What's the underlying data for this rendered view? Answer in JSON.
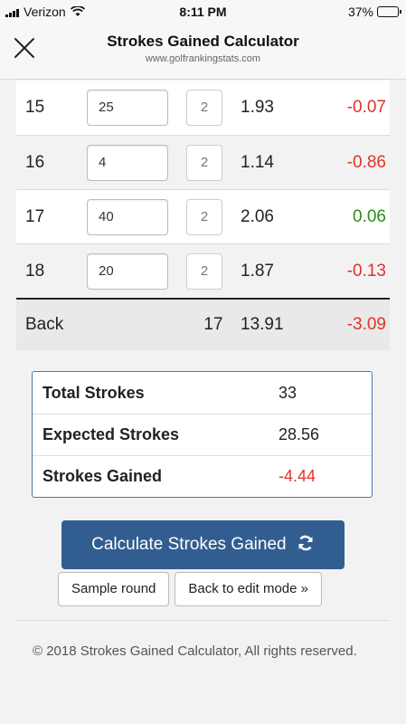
{
  "status_bar": {
    "carrier": "Verizon",
    "time": "8:11 PM",
    "battery": "37%",
    "battery_level": 0.37
  },
  "nav": {
    "title": "Strokes Gained Calculator",
    "url": "www.golfrankingstats.com"
  },
  "holes": [
    {
      "hole": "15",
      "distance": "25",
      "putts": "2",
      "expected": "1.93",
      "gained": "-0.07"
    },
    {
      "hole": "16",
      "distance": "4",
      "putts": "2",
      "expected": "1.14",
      "gained": "-0.86"
    },
    {
      "hole": "17",
      "distance": "40",
      "putts": "2",
      "expected": "2.06",
      "gained": "0.06"
    },
    {
      "hole": "18",
      "distance": "20",
      "putts": "2",
      "expected": "1.87",
      "gained": "-0.13"
    }
  ],
  "back": {
    "label": "Back",
    "strokes": "17",
    "expected": "13.91",
    "gained": "-3.09"
  },
  "summary": {
    "total_label": "Total Strokes",
    "total_value": "33",
    "expected_label": "Expected Strokes",
    "expected_value": "28.56",
    "gained_label": "Strokes Gained",
    "gained_value": "-4.44"
  },
  "buttons": {
    "calculate": "Calculate Strokes Gained",
    "sample": "Sample round",
    "back_edit": "Back to edit mode »"
  },
  "footer": {
    "text": "© 2018 Strokes Gained Calculator, All rights reserved."
  },
  "colors": {
    "negative": "#e03327",
    "positive": "#2e8b1e",
    "primary_button": "#325d91",
    "summary_border": "#4a79a8"
  }
}
